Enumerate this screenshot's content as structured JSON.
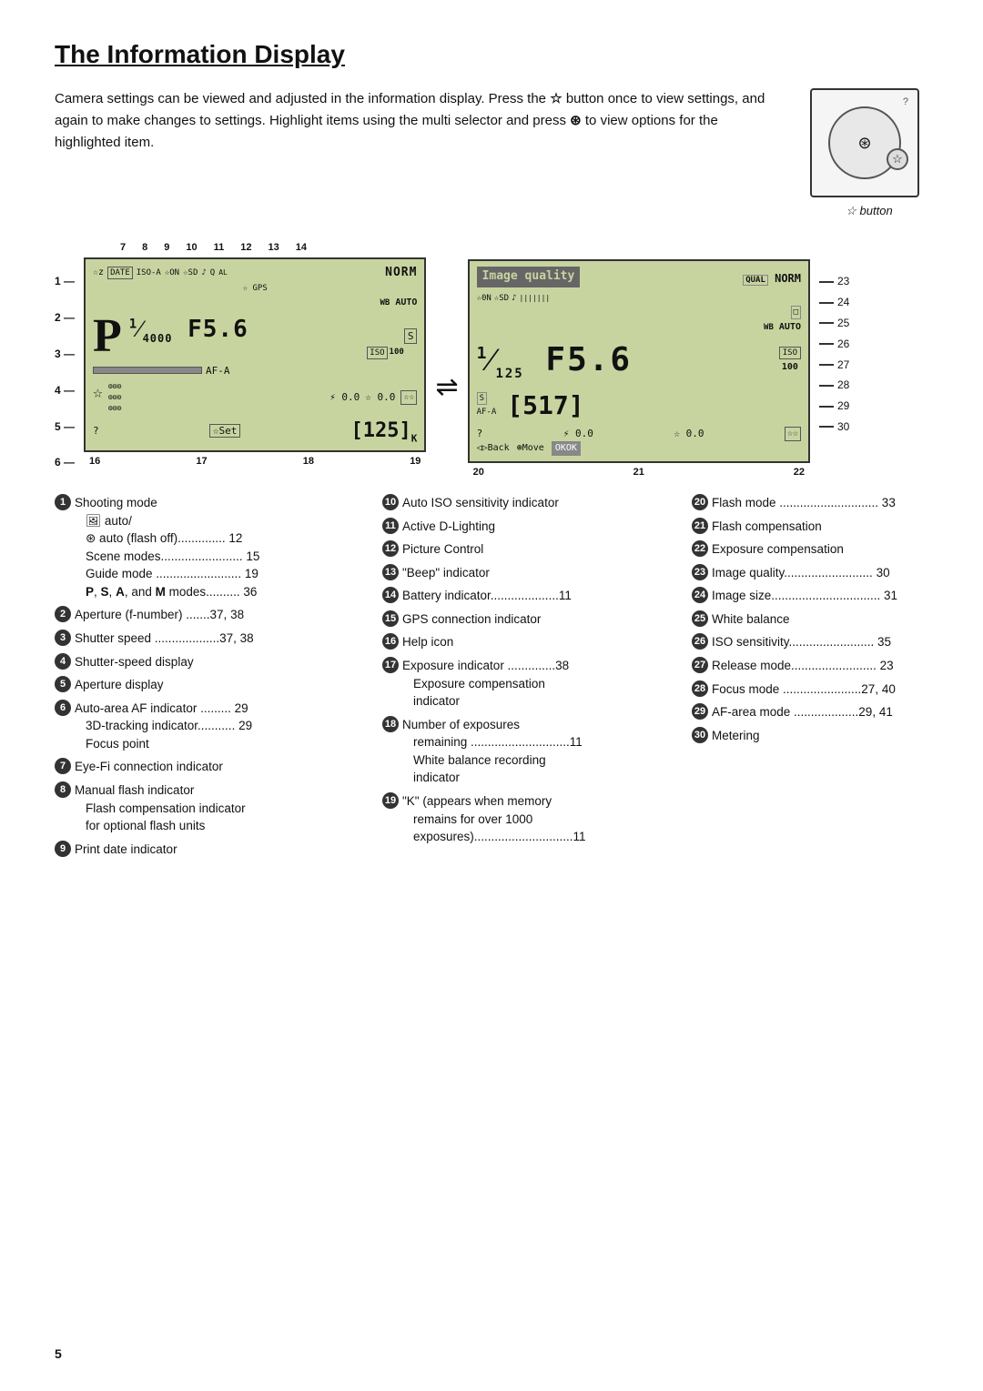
{
  "page": {
    "title": "The Information Display",
    "page_number": "5",
    "intro": "Camera settings can be viewed and adjusted in the information display. Press the ☆ button once to view settings, and again to make changes to settings. Highlight items using the multi selector and press ⊛ to view options for the highlighted item.",
    "button_label": "☆ button"
  },
  "diagram": {
    "top_numbers_left": [
      "1",
      "7",
      "8",
      "9",
      "10",
      "11",
      "12",
      "13",
      "14"
    ],
    "left_numbers": [
      "2",
      "3",
      "4",
      "5",
      "6"
    ],
    "bottom_numbers_left": [
      "16",
      "17",
      "18",
      "19"
    ],
    "bottom_numbers_right": [
      "20",
      "21",
      "22"
    ],
    "right_side_numbers": [
      "23",
      "24",
      "25",
      "26",
      "27",
      "28",
      "29",
      "30"
    ],
    "right_side_labels": [
      "— 23",
      "— 24",
      "— 25",
      "— 26",
      "— 27",
      "— 28",
      "— 29",
      "— 30"
    ],
    "lcd_left": {
      "row1": "☆z DATE ISO-A ☆ON ☆SD ♪ Q  NORM",
      "row1_right": "NORM",
      "gps": "GPS",
      "wb": "WB AUTO",
      "iso": "ISO 100",
      "shutter": "¹⁄4000",
      "aperture": "F5.6",
      "bracket_s": "S",
      "af_a": "AF-A",
      "exposure_val": "0.0",
      "comp_val": "0.0",
      "frames": "125",
      "set_label": "Set"
    },
    "lcd_right": {
      "title": "Image quality",
      "norm": "NORM",
      "norm_right": "NORM",
      "icons_row": "☆0N☆SD ♪ |||||||",
      "wb": "WB AUTO",
      "iso": "ISO 100",
      "shutter": "¹⁄125",
      "aperture": "F5.6",
      "bracket": "[517]",
      "auto": "AUTO",
      "exposure_val": "0.0",
      "comp_val": "0.0",
      "nav": "Back  Move  OKOK"
    }
  },
  "items_col1": [
    {
      "num": "1",
      "label": "Shooting mode",
      "sub": [
        "🖼 auto/",
        "⊛ auto (flash off).............. 12",
        "Scene modes........................ 15",
        "Guide mode ......................... 19",
        "P, S, A, and M modes.......... 36"
      ]
    },
    {
      "num": "2",
      "label": "Aperture (f-number) .......37, 38"
    },
    {
      "num": "3",
      "label": "Shutter speed ...................37, 38"
    },
    {
      "num": "4",
      "label": "Shutter-speed display"
    },
    {
      "num": "5",
      "label": "Aperture display"
    },
    {
      "num": "6",
      "label": "Auto-area AF indicator ......... 29",
      "sub": [
        "3D-tracking indicator........... 29",
        "Focus point"
      ]
    },
    {
      "num": "7",
      "label": "Eye-Fi connection indicator"
    },
    {
      "num": "8",
      "label": "Manual flash indicator",
      "sub": [
        "Flash compensation indicator",
        "  for optional flash units"
      ]
    },
    {
      "num": "9",
      "label": "Print date indicator"
    }
  ],
  "items_col2": [
    {
      "num": "10",
      "label": "Auto ISO sensitivity indicator"
    },
    {
      "num": "11",
      "label": "Active D-Lighting"
    },
    {
      "num": "12",
      "label": "Picture Control"
    },
    {
      "num": "13",
      "label": "\"Beep\" indicator"
    },
    {
      "num": "14",
      "label": "Battery indicator....................11"
    },
    {
      "num": "15",
      "label": "GPS connection indicator"
    },
    {
      "num": "16",
      "label": "Help icon"
    },
    {
      "num": "17",
      "label": "Exposure indicator ..............38",
      "sub": [
        "Exposure compensation",
        "  indicator"
      ]
    },
    {
      "num": "18",
      "label": "Number of exposures",
      "sub": [
        "  remaining .............................11",
        "White balance recording",
        "  indicator"
      ]
    },
    {
      "num": "19",
      "label": "\"K\" (appears when memory",
      "sub": [
        "  remains for over 1000",
        "  exposures).............................11"
      ]
    }
  ],
  "items_col3": [
    {
      "num": "20",
      "label": "Flash mode ............................. 33"
    },
    {
      "num": "21",
      "label": "Flash compensation"
    },
    {
      "num": "22",
      "label": "Exposure compensation"
    },
    {
      "num": "23",
      "label": "Image quality.......................... 30"
    },
    {
      "num": "24",
      "label": "Image size................................ 31"
    },
    {
      "num": "25",
      "label": "White balance"
    },
    {
      "num": "26",
      "label": "ISO sensitivity......................... 35"
    },
    {
      "num": "27",
      "label": "Release mode......................... 23"
    },
    {
      "num": "28",
      "label": "Focus mode .......................27, 40"
    },
    {
      "num": "29",
      "label": "AF-area mode ...................29, 41"
    },
    {
      "num": "30",
      "label": "Metering"
    }
  ]
}
